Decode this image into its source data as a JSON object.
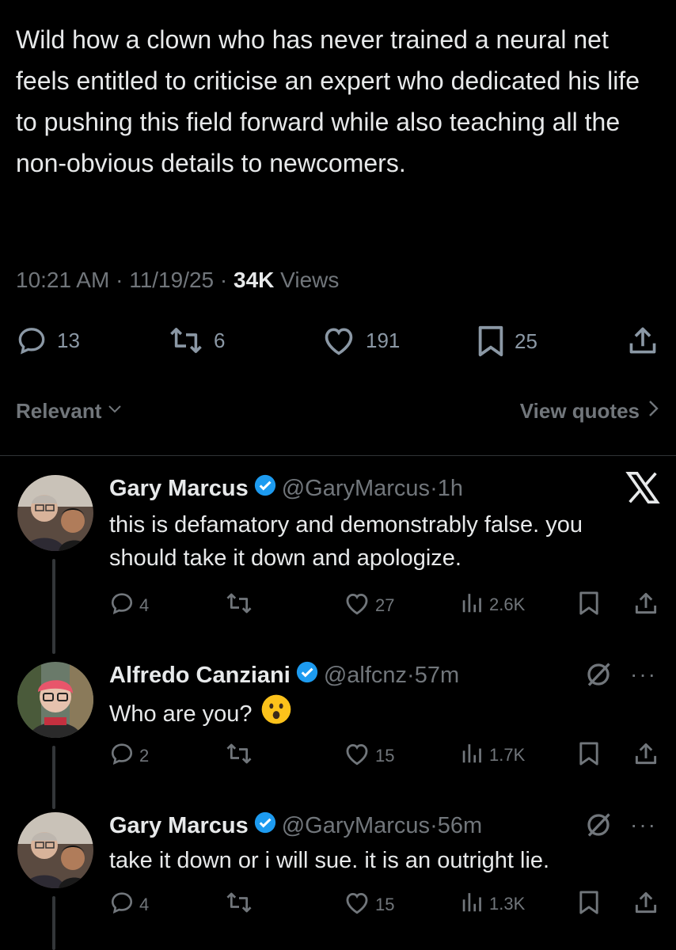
{
  "tweet": {
    "text": "Wild how a clown who has never trained a neural net feels entitled to criticise an expert who dedicated his life to pushing this field forward while also teaching all the non-obvious details to newcomers.",
    "time": "10:21 AM",
    "date": "11/19/25",
    "views_count": "34K",
    "views_label": "Views",
    "replies": "13",
    "reposts": "6",
    "likes": "191",
    "bookmarks": "25"
  },
  "sort": {
    "label": "Relevant",
    "view_quotes": "View quotes"
  },
  "replies": [
    {
      "name": "Gary Marcus",
      "handle": "@GaryMarcus",
      "time": "1h",
      "text": "this is defamatory and demonstrably false. you should take it down and apologize.",
      "replies": "4",
      "reposts": "",
      "likes": "27",
      "views": "2.6K"
    },
    {
      "name": "Alfredo Canziani",
      "handle": "@alfcnz",
      "time": "57m",
      "text": "Who are you?",
      "emoji": "😮",
      "replies": "2",
      "reposts": "",
      "likes": "15",
      "views": "1.7K"
    },
    {
      "name": "Gary Marcus",
      "handle": "@GaryMarcus",
      "time": "56m",
      "text": "take it down or i will sue. it is an outright lie.",
      "replies": "4",
      "reposts": "",
      "likes": "15",
      "views": "1.3K"
    }
  ],
  "colors": {
    "background": "#000000",
    "text": "#e7e9ea",
    "muted": "#71767b",
    "verified": "#1d9bf0"
  },
  "icons": [
    "reply-icon",
    "repost-icon",
    "like-icon",
    "bookmark-icon",
    "share-icon",
    "views-icon",
    "verified-icon",
    "x-logo-icon",
    "grok-icon",
    "more-icon",
    "chevron-down-icon",
    "chevron-right-icon"
  ]
}
